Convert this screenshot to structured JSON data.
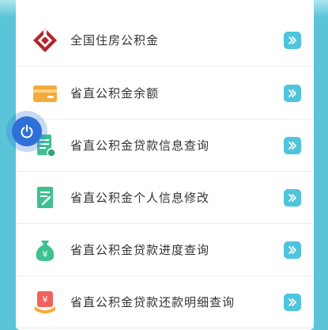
{
  "colors": {
    "page_background": "#5bc4d9",
    "arrow_button": "#4ec5dd",
    "float_button": "#2f6fd8"
  },
  "menu": {
    "items": [
      {
        "label": "全国住房公积金",
        "icon": "housing-fund-logo-icon"
      },
      {
        "label": "省直公积金余额",
        "icon": "card-icon"
      },
      {
        "label": "省直公积金贷款信息查询",
        "icon": "document-search-icon"
      },
      {
        "label": "省直公积金个人信息修改",
        "icon": "edit-document-icon"
      },
      {
        "label": "省直公积金贷款进度查询",
        "icon": "money-bag-icon"
      },
      {
        "label": "省直公积金贷款还款明细查询",
        "icon": "repayment-receipt-icon"
      }
    ]
  },
  "floating_button": {
    "icon": "power-icon"
  }
}
